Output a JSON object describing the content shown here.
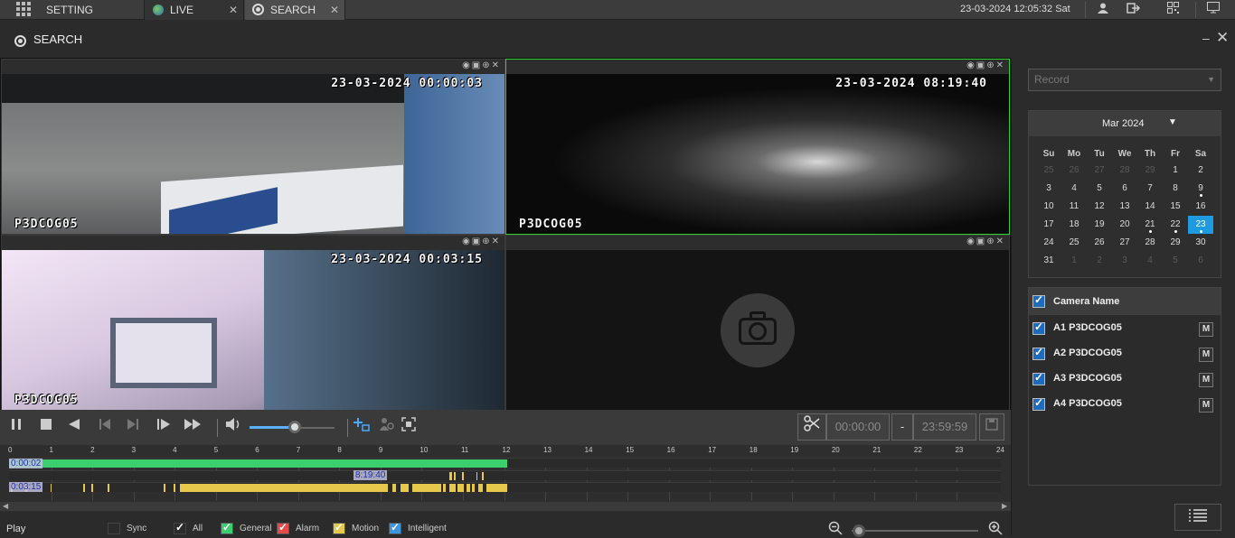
{
  "topbar": {
    "tabs": [
      {
        "label": "SETTING",
        "icon": "grid-icon"
      },
      {
        "label": "LIVE",
        "icon": "globe-icon"
      },
      {
        "label": "SEARCH",
        "icon": "search-film-icon"
      }
    ],
    "tab_close": "✕",
    "datetime": "23-03-2024 12:05:32 Sat"
  },
  "page": {
    "title": "SEARCH",
    "minimize": "–",
    "close": "✕"
  },
  "panes": [
    {
      "osd_time": "23-03-2024 00:00:03",
      "osd_name": "P3DCOG05",
      "active": false
    },
    {
      "osd_time": "23-03-2024 08:19:40",
      "osd_name": "P3DCOG05",
      "active": true
    },
    {
      "osd_time": "23-03-2024 00:03:15",
      "osd_name": "P3DCOG05",
      "active": false
    },
    {
      "osd_time": "",
      "osd_name": "",
      "active": false,
      "no_video_icon": "camera-off-icon"
    }
  ],
  "pane_tools": "◉▣⊕✕",
  "controls": {
    "start_time": "00:00:00",
    "dash": "-",
    "end_time": "23:59:59",
    "volume": 0.52
  },
  "timeline": {
    "hours": [
      "0",
      "1",
      "2",
      "3",
      "4",
      "5",
      "6",
      "7",
      "8",
      "9",
      "10",
      "11",
      "12",
      "13",
      "14",
      "15",
      "16",
      "17",
      "18",
      "19",
      "20",
      "21",
      "22",
      "23",
      "24"
    ],
    "track1_label": "0:00:02",
    "track2_label": "8:19:40",
    "track3_label": "0:03:15",
    "scroll_left": "◀",
    "scroll_right": "▶"
  },
  "legend": {
    "play": "Play",
    "sync": "Sync",
    "all": "All",
    "general": "General",
    "alarm": "Alarm",
    "motion": "Motion",
    "intelligent": "Intelligent"
  },
  "colors": {
    "general": "#3ccf6e",
    "alarm": "#e84a4a",
    "motion": "#e6c94a",
    "intelligent": "#3a97e0",
    "selected": "#1e9ae0"
  },
  "right": {
    "record_select": "Record",
    "calendar": {
      "month": "Mar 2024",
      "dow": [
        "Su",
        "Mo",
        "Tu",
        "We",
        "Th",
        "Fr",
        "Sa"
      ],
      "weeks": [
        [
          "25",
          "26",
          "27",
          "28",
          "29",
          "1",
          "2"
        ],
        [
          "3",
          "4",
          "5",
          "6",
          "7",
          "8",
          "9"
        ],
        [
          "10",
          "11",
          "12",
          "13",
          "14",
          "15",
          "16"
        ],
        [
          "17",
          "18",
          "19",
          "20",
          "21",
          "22",
          "23"
        ],
        [
          "24",
          "25",
          "26",
          "27",
          "28",
          "29",
          "30"
        ],
        [
          "31",
          "1",
          "2",
          "3",
          "4",
          "5",
          "6"
        ]
      ]
    },
    "camera_header": "Camera Name",
    "cameras": [
      "A1 P3DCOG05",
      "A2 P3DCOG05",
      "A3 P3DCOG05",
      "A4 P3DCOG05"
    ],
    "m_label": "M"
  }
}
